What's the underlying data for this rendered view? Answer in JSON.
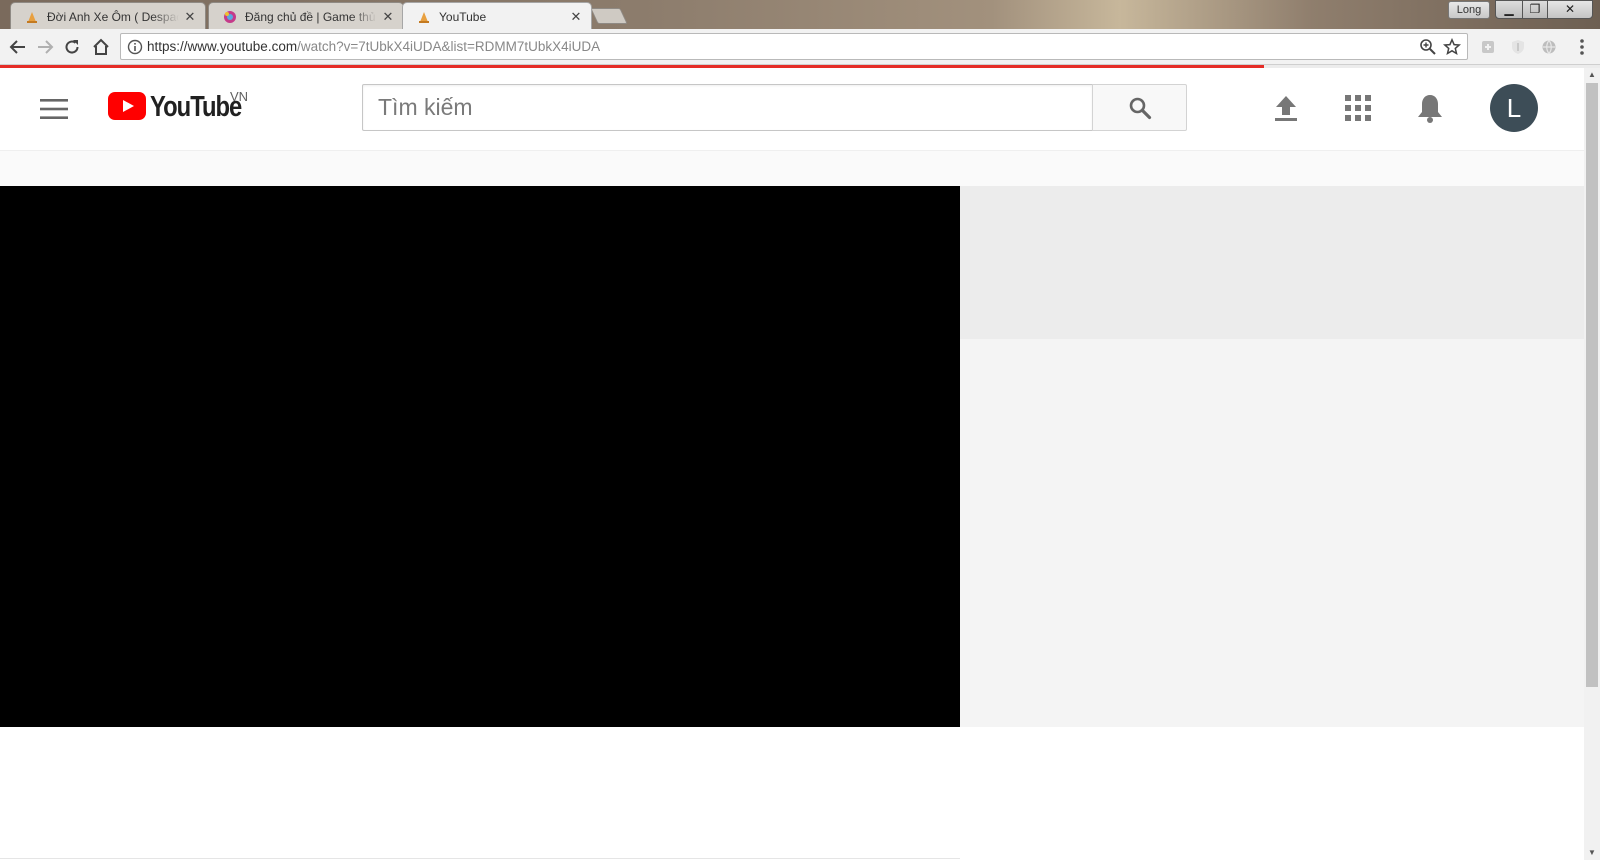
{
  "browser": {
    "tabs": [
      {
        "title": "Đời Anh Xe Ôm ( Despacito",
        "active": false
      },
      {
        "title": "Đăng chủ đề | Game thủ",
        "active": false
      },
      {
        "title": "YouTube",
        "active": true
      }
    ],
    "profile_name": "Long",
    "url_host": "https://www.youtube.com",
    "url_path": "/watch?v=7tUbkX4iUDA&list=RDMM7tUbkX4iUDA",
    "load_progress": 0.79
  },
  "youtube": {
    "logo_word": "YouTube",
    "region": "VN",
    "search_placeholder": "Tìm kiếm",
    "avatar_letter": "L",
    "brand_red": "#ff0000",
    "avatar_color": "#3d4d57"
  }
}
